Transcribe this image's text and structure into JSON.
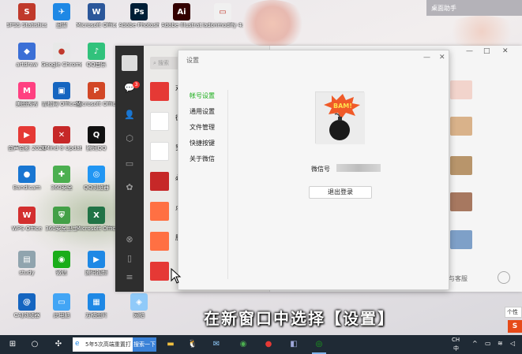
{
  "widget": {
    "title": "桌面助手"
  },
  "desktop_icons": [
    {
      "label": "SPSS Statistics",
      "color": "#c0392b",
      "glyph": "S"
    },
    {
      "label": "迅雷",
      "color": "#1e88e5",
      "glyph": "✈"
    },
    {
      "label": "Microsoft Office Wor...",
      "color": "#2b579a",
      "glyph": "W"
    },
    {
      "label": "Adobe Photosho...",
      "color": "#001e36",
      "glyph": "Ps"
    },
    {
      "label": "Adobe Illustrat...",
      "color": "#330000",
      "glyph": "Ai"
    },
    {
      "label": "ladonmodify 4.0.5.1757",
      "color": "#f0f0f0",
      "glyph": "▭"
    },
    {
      "label": "artdraw",
      "color": "#3b6fd6",
      "glyph": "◆"
    },
    {
      "label": "Google Chrome",
      "color": "#e8e8e8",
      "glyph": "●"
    },
    {
      "label": "QQ音乐",
      "color": "#31c27c",
      "glyph": "♪"
    },
    {
      "label": "美图秀秀",
      "color": "#ff4081",
      "glyph": "M"
    },
    {
      "label": "青松网 Office版",
      "color": "#1565c0",
      "glyph": "▣"
    },
    {
      "label": "Microsoft Office Po...",
      "color": "#d24726",
      "glyph": "P"
    },
    {
      "label": "会声会影 2021",
      "color": "#e53935",
      "glyph": "▶"
    },
    {
      "label": "XMind 8 Update 8",
      "color": "#c62828",
      "glyph": "✕"
    },
    {
      "label": "腾讯QQ",
      "color": "#111",
      "glyph": "Q"
    },
    {
      "label": "Bandicam",
      "color": "#1976d2",
      "glyph": "●"
    },
    {
      "label": "360安全",
      "color": "#4caf50",
      "glyph": "✚"
    },
    {
      "label": "QQ浏览器",
      "color": "#2196f3",
      "glyph": "◎"
    },
    {
      "label": "WPS Office",
      "color": "#d32f2f",
      "glyph": "W"
    },
    {
      "label": "360安全卫士",
      "color": "#43a047",
      "glyph": "⛨"
    },
    {
      "label": "Microsoft Office Exc...",
      "color": "#217346",
      "glyph": "X"
    },
    {
      "label": "study",
      "color": "#90a4ae",
      "glyph": "▤"
    },
    {
      "label": "微信",
      "color": "#1aad19",
      "glyph": "◉"
    },
    {
      "label": "腾讯视频",
      "color": "#1e88e5",
      "glyph": "▶"
    },
    {
      "label": "CAJ浏览器",
      "color": "#1565c0",
      "glyph": "@"
    },
    {
      "label": "此电脑",
      "color": "#42a5f5",
      "glyph": "▭"
    },
    {
      "label": "方格图片",
      "color": "#1e88e5",
      "glyph": "▦"
    },
    {
      "label": "网络",
      "color": "#90caf9",
      "glyph": "◈"
    }
  ],
  "wechat": {
    "search_placeholder": "搜索",
    "unread_badge": "3",
    "chats": [
      {
        "name": "对",
        "color": "#e53935"
      },
      {
        "name": "德",
        "color": "#ffffff"
      },
      {
        "name": "罗",
        "color": "#ffffff"
      },
      {
        "name": "必",
        "color": "#c62828"
      },
      {
        "name": "点",
        "color": "#ff7043"
      },
      {
        "name": "服",
        "color": "#ff7043"
      },
      {
        "name": "",
        "color": "#e53935"
      }
    ],
    "footer_text": "册与客服",
    "window_controls": [
      "—",
      "□",
      "✕"
    ]
  },
  "settings": {
    "title": "设置",
    "menu": [
      "帐号设置",
      "通用设置",
      "文件管理",
      "快捷按键",
      "关于微信"
    ],
    "active_index": 0,
    "wechat_id_label": "微信号",
    "logout_label": "退出登录",
    "profile_text": "BAM!",
    "window_controls": [
      "—",
      "✕"
    ]
  },
  "caption": "在新窗口中选择【设置】",
  "notification": {
    "text": "个性",
    "logo": "S"
  },
  "taskbar": {
    "search_text": "5年5次高端重置打",
    "search_button": "搜索一下",
    "tray": {
      "ime": "中",
      "ime_sub": "CH"
    }
  }
}
